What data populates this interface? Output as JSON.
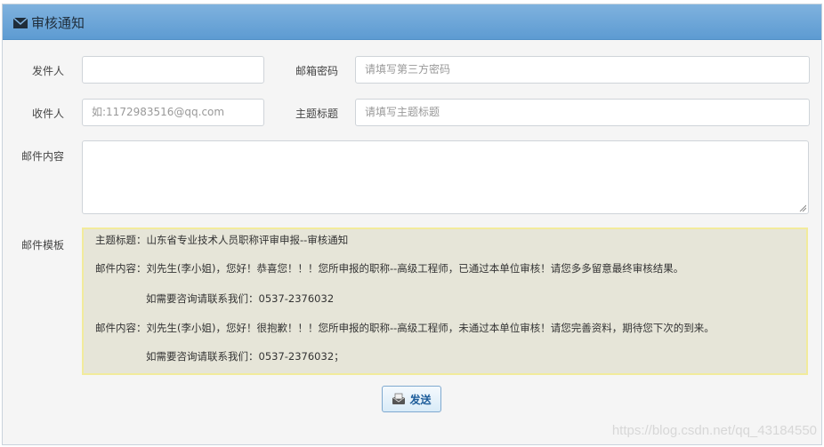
{
  "panel": {
    "title": "审核通知",
    "icon": "envelope-icon"
  },
  "form": {
    "sender": {
      "label": "发件人",
      "value": "",
      "placeholder": ""
    },
    "email_password": {
      "label": "邮箱密码",
      "placeholder": "请填写第三方密码"
    },
    "recipient": {
      "label": "收件人",
      "placeholder": "如:1172983516@qq.com"
    },
    "subject": {
      "label": "主题标题",
      "placeholder": "请填写主题标题"
    },
    "content": {
      "label": "邮件内容",
      "value": ""
    },
    "template": {
      "label": "邮件模板",
      "lines": [
        "主题标题：山东省专业技术人员职称评审申报--审核通知",
        "邮件内容：刘先生(李小姐)，您好！恭喜您！！！您所申报的职称--高级工程师，已通过本单位审核！请您多多留意最终审核结果。",
        "如需要咨询请联系我们：0537-2376032",
        "邮件内容：刘先生(李小姐)，您好！很抱歉！！！您所申报的职称--高级工程师，未通过本单位审核！请您完善资料，期待您下次的到来。",
        "如需要咨询请联系我们：0537-2376032；"
      ]
    }
  },
  "actions": {
    "send_label": "发送",
    "send_icon": "send-mail-icon"
  },
  "watermark": "https://blog.csdn.net/qq_43184550",
  "colors": {
    "header": "#6aa6d8",
    "template_bg": "#e6e5d8",
    "template_border": "#f2eb9c",
    "button_text": "#1d5c9a"
  }
}
